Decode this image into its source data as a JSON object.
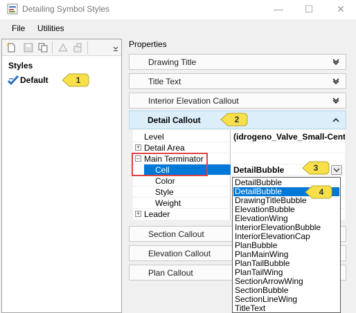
{
  "window": {
    "title": "Detailing Symbol Styles"
  },
  "menu": {
    "file": "File",
    "utilities": "Utilities"
  },
  "styles": {
    "heading": "Styles",
    "default": "Default"
  },
  "properties": {
    "label": "Properties",
    "sections": {
      "drawing_title": "Drawing Title",
      "title_text": "Title Text",
      "interior_elevation_callout": "Interior Elevation Callout",
      "detail_callout": "Detail Callout",
      "section_callout": "Section Callout",
      "elevation_callout": "Elevation Callout",
      "plan_callout": "Plan Callout"
    },
    "grid": {
      "level": {
        "name": "Level",
        "value": "(idrogeno_Valve_Small-Cent"
      },
      "detail_area": {
        "name": "Detail Area"
      },
      "main_terminator": {
        "name": "Main Terminator"
      },
      "cell": {
        "name": "Cell",
        "value": "DetailBubble"
      },
      "color": {
        "name": "Color"
      },
      "style": {
        "name": "Style"
      },
      "weight": {
        "name": "Weight"
      },
      "leader": {
        "name": "Leader"
      }
    }
  },
  "cell_options": [
    "DetailBubble",
    "DrawingTitleBubble",
    "ElevationBubble",
    "ElevationWing",
    "InteriorElevationBubble",
    "InteriorElevationCap",
    "PlanBubble",
    "PlanMainWing",
    "PlanTailBubble",
    "PlanTailWing",
    "SectionArrowWing",
    "SectionBubble",
    "SectionLineWing",
    "TitleText"
  ],
  "callouts": {
    "c1": "1",
    "c2": "2",
    "c3": "3",
    "c4": "4"
  },
  "colors": {
    "selection": "#0078d7",
    "callout": "#f7e04a",
    "highlight": "#e04040"
  }
}
